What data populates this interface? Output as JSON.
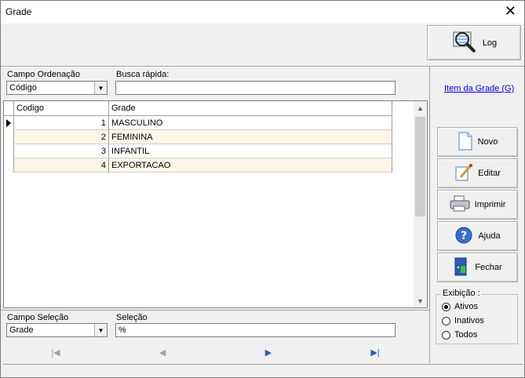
{
  "window": {
    "title": "Grade",
    "close_glyph": "✕"
  },
  "toolbar": {
    "log_label": "Log"
  },
  "sort": {
    "label": "Campo Ordenação",
    "value": "Código"
  },
  "quick_search": {
    "label": "Busca rápida:",
    "value": ""
  },
  "link": {
    "label": "Item da Grade (G)"
  },
  "table": {
    "columns": [
      "Codigo",
      "Grade"
    ],
    "rows": [
      {
        "codigo": "1",
        "grade": "MASCULINO"
      },
      {
        "codigo": "2",
        "grade": "FEMININA"
      },
      {
        "codigo": "3",
        "grade": "INFANTIL"
      },
      {
        "codigo": "4",
        "grade": "EXPORTACAO"
      }
    ]
  },
  "actions": {
    "novo": "Novo",
    "editar": "Editar",
    "imprimir": "Imprimir",
    "ajuda": "Ajuda",
    "fechar": "Fechar"
  },
  "filter": {
    "field_label": "Campo Seleção",
    "field_value": "Grade",
    "selection_label": "Seleção",
    "selection_value": "%"
  },
  "display": {
    "title": "Exibição :",
    "options": [
      "Ativos",
      "Inativos",
      "Todos"
    ],
    "selected": "Ativos"
  },
  "nav": {
    "first": "|◀",
    "prev": "◀",
    "next": "▶",
    "last": "▶|"
  },
  "colors": {
    "row_alt": "#fdf5e6",
    "link": "#0000ee",
    "nav_active": "#1f5fbf"
  }
}
